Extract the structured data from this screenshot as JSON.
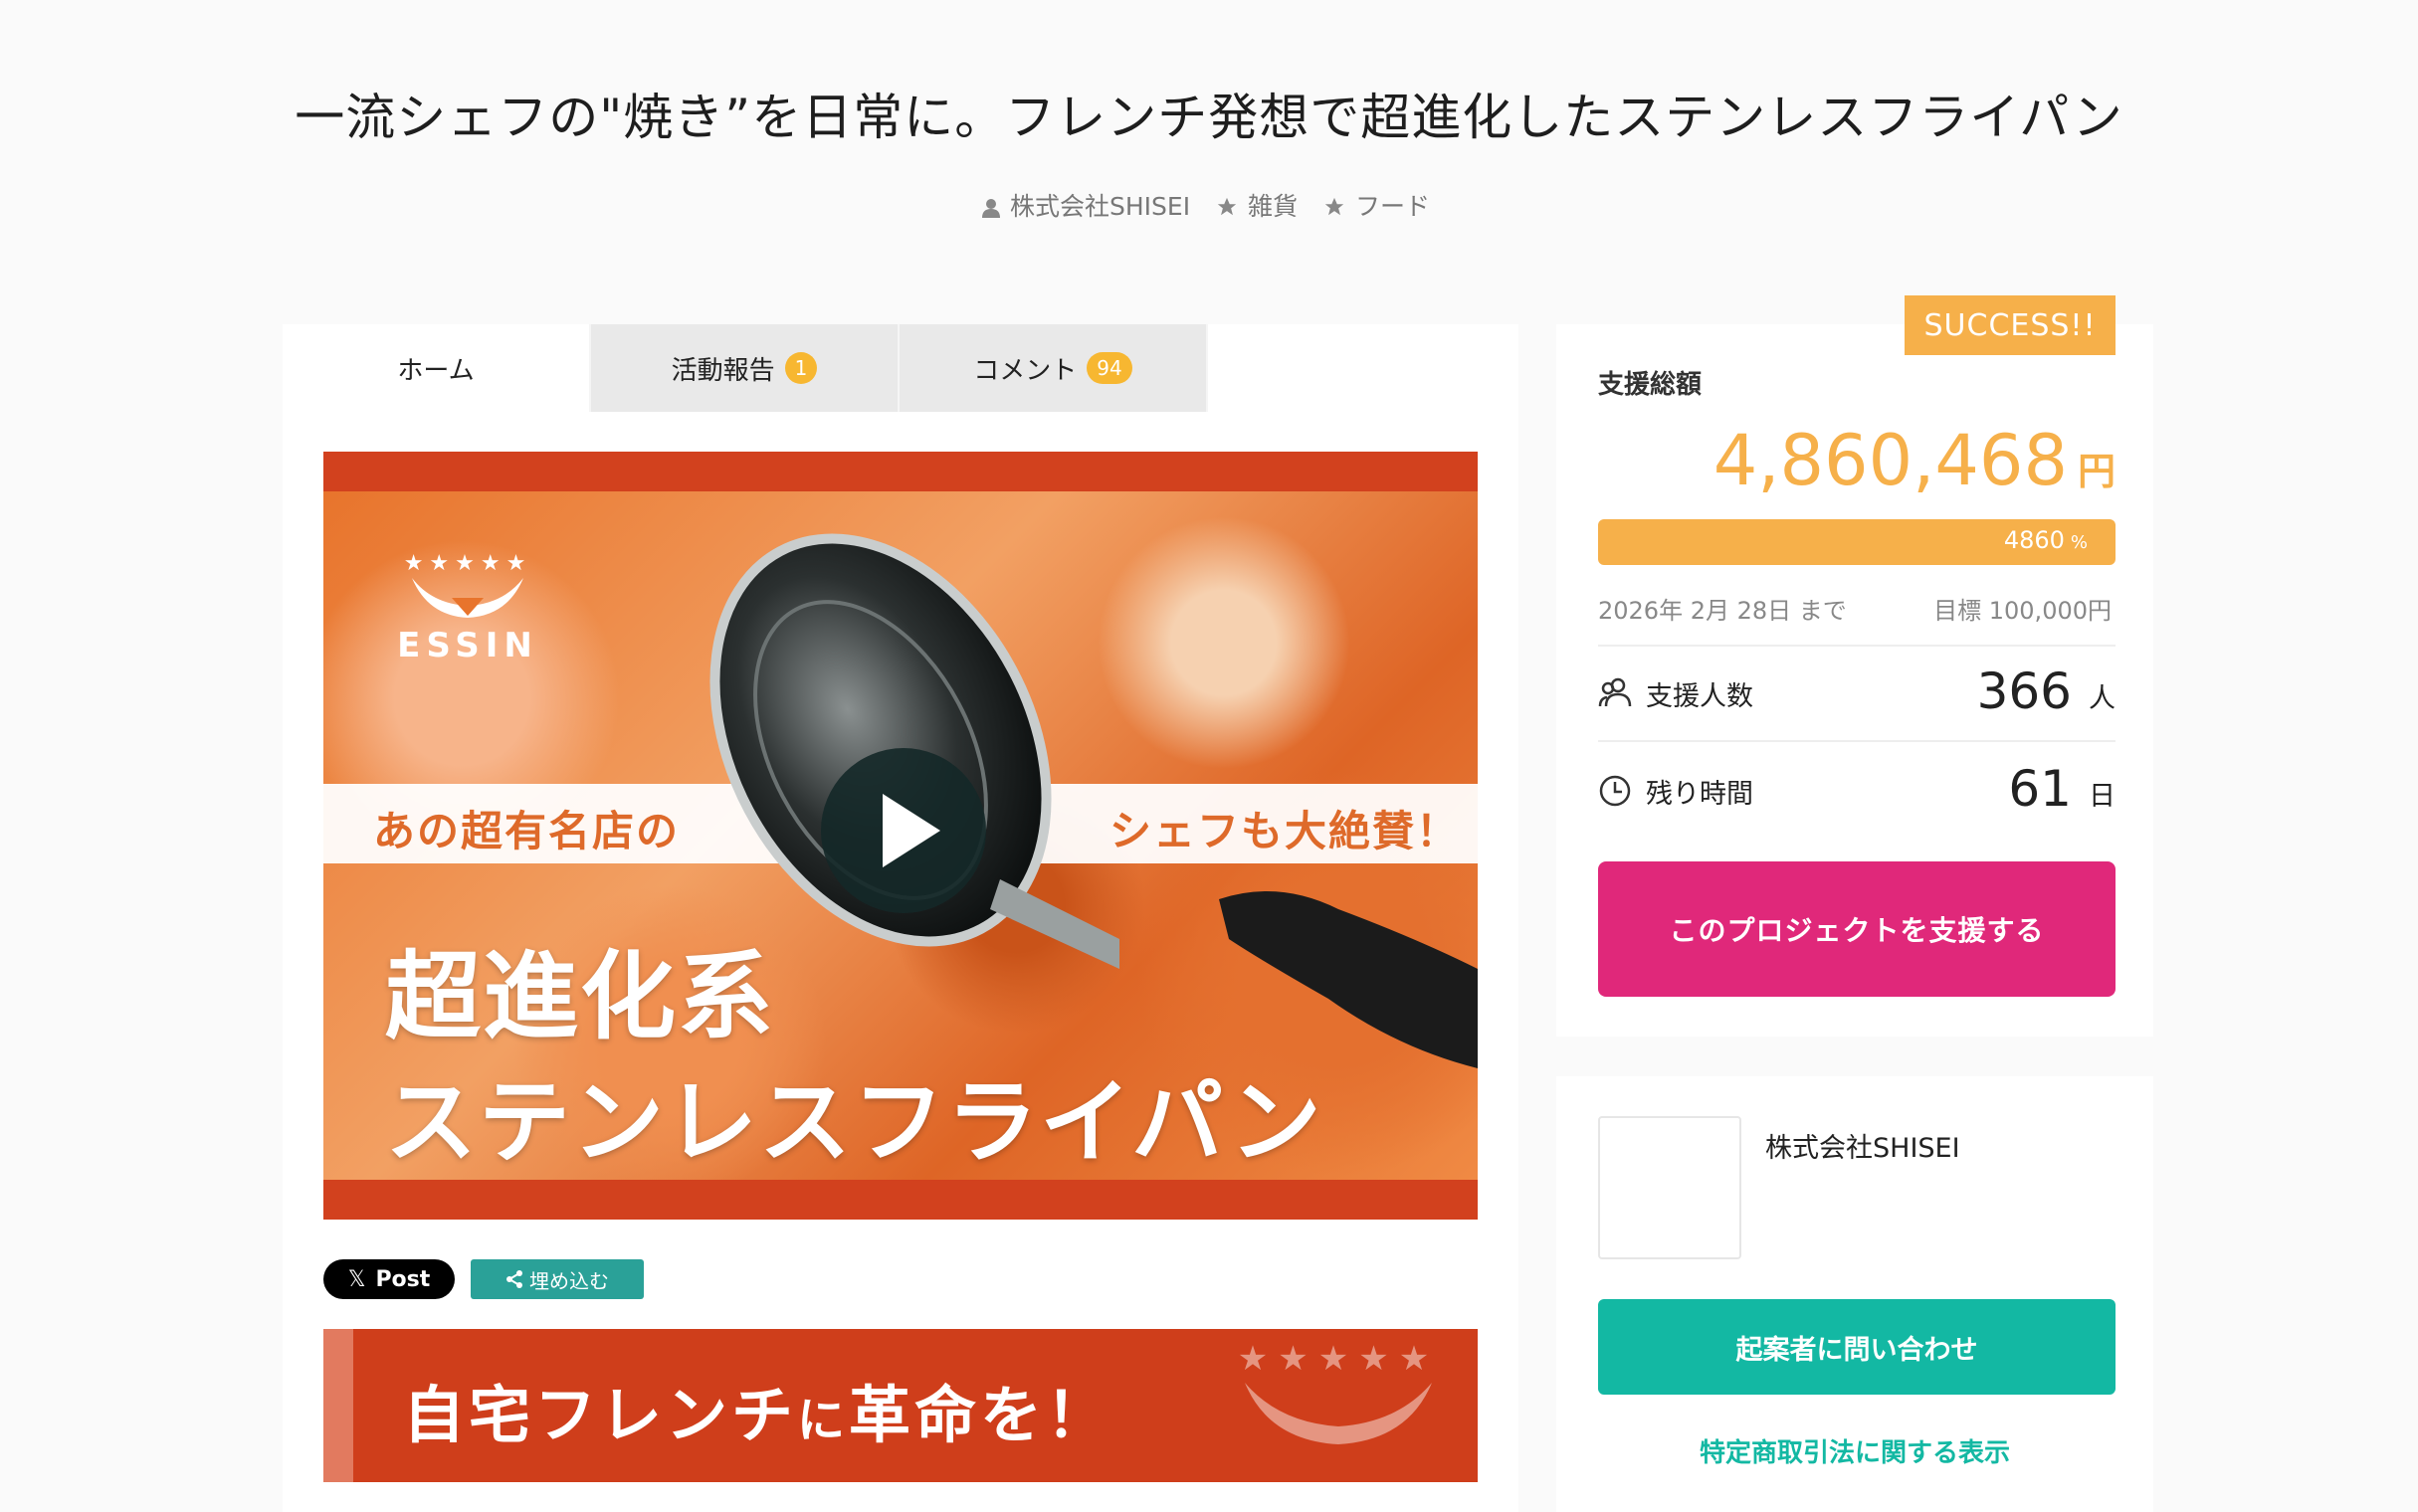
{
  "header": {
    "title": "一流シェフの\"焼き”を日常に。フレンチ発想で超進化したステンレスフライパン",
    "owner": "株式会社SHISEI",
    "categories": [
      "雑貨",
      "フード"
    ]
  },
  "tabs": [
    {
      "label": "ホーム",
      "badge": null
    },
    {
      "label": "活動報告",
      "badge": "1"
    },
    {
      "label": "コメント",
      "badge": "94"
    }
  ],
  "hero": {
    "brand": "ESSIN",
    "brand_stars": "★★★★★",
    "band_left": "あの超有名店の",
    "band_right": "シェフも大絶賛！",
    "headline_1": "超進化系",
    "headline_2": "ステンレスフライパン"
  },
  "share": {
    "x_label": "Post",
    "embed_label": "埋め込む"
  },
  "banner2": {
    "text_a": "自宅フレンチ",
    "text_b": "に",
    "text_c": "革命を！",
    "stars": "★★★★★"
  },
  "funding": {
    "status": "SUCCESS!!",
    "label": "支援総額",
    "amount": "4,860,468",
    "currency": "円",
    "percent": "4860",
    "percent_unit": "%",
    "progress_fraction": 1.0,
    "deadline": "2026年 2月 28日 まで",
    "goal": "目標 100,000円",
    "supporters_label": "支援人数",
    "supporters_value": "366",
    "supporters_unit": "人",
    "remaining_label": "残り時間",
    "remaining_value": "61",
    "remaining_unit": "日",
    "support_button": "このプロジェクトを支援する"
  },
  "owner": {
    "name": "株式会社SHISEI",
    "contact_button": "起案者に問い合わせ",
    "law_link": "特定商取引法に関する表示"
  },
  "colors": {
    "accent": "#f6b04a",
    "support": "#e0287a",
    "contact": "#13b8a3"
  }
}
